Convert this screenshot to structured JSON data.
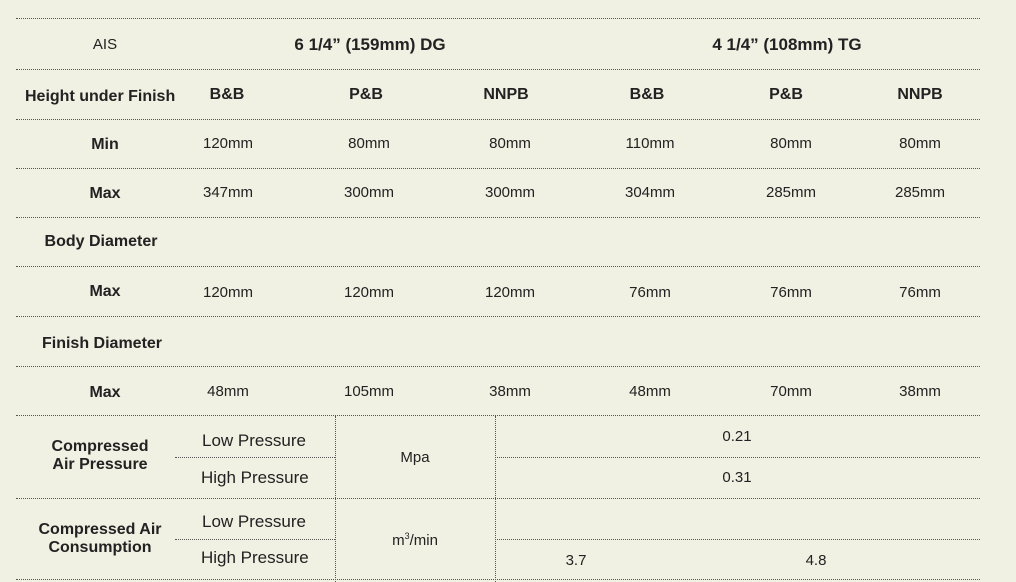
{
  "header": {
    "ais": "AIS",
    "group_dg": "6 1/4” (159mm) DG",
    "group_tg": "4 1/4” (108mm) TG"
  },
  "height_under_finish": {
    "label": "Height under Finish",
    "types": [
      "B&B",
      "P&B",
      "NNPB",
      "B&B",
      "P&B",
      "NNPB"
    ],
    "min": {
      "label": "Min",
      "values": [
        "120mm",
        "80mm",
        "80mm",
        "110mm",
        "80mm",
        "80mm"
      ]
    },
    "max": {
      "label": "Max",
      "values": [
        "347mm",
        "300mm",
        "300mm",
        "304mm",
        "285mm",
        "285mm"
      ]
    }
  },
  "body_diameter": {
    "label": "Body Diameter",
    "max": {
      "label": "Max",
      "values": [
        "120mm",
        "120mm",
        "120mm",
        "76mm",
        "76mm",
        "76mm"
      ]
    }
  },
  "finish_diameter": {
    "label": "Finish Diameter",
    "max": {
      "label": "Max",
      "values": [
        "48mm",
        "105mm",
        "38mm",
        "48mm",
        "70mm",
        "38mm"
      ]
    }
  },
  "compressed_air_pressure": {
    "label": "Compressed\nAir Pressure",
    "low_label": "Low Pressure",
    "high_label": "High Pressure",
    "unit": "Mpa",
    "low_value": "0.21",
    "high_value": "0.31"
  },
  "compressed_air_consumption": {
    "label": "Compressed Air\nConsumption",
    "low_label": "Low Pressure",
    "high_label": "High Pressure",
    "unit_base": "m",
    "unit_sup": "3",
    "unit_tail": "/min",
    "value_dg": "3.7",
    "value_tg": "4.8"
  }
}
